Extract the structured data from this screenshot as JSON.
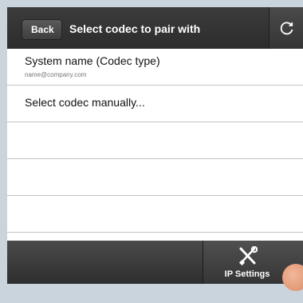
{
  "header": {
    "back_label": "Back",
    "title": "Select codec to pair with",
    "refresh_icon": "refresh-icon"
  },
  "list": {
    "items": [
      {
        "name": "System name (Codec type)",
        "detail": "name@company.com"
      },
      {
        "name": "Select codec manually..."
      }
    ]
  },
  "bottom_bar": {
    "ip_settings_label": "IP Settings",
    "ip_settings_icon": "tools-icon"
  },
  "colors": {
    "header_bg": "#2f2f2f",
    "bar_bg": "#3a3a3a",
    "list_bg": "#ffffff",
    "frame_bg": "#c9d4dc"
  }
}
